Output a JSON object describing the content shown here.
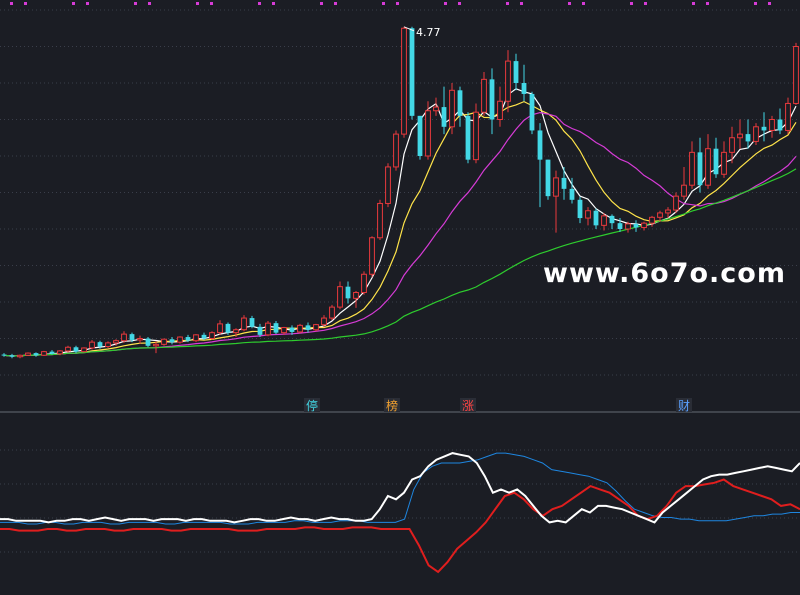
{
  "watermark": "www.6o7o.com",
  "chart_data": {
    "type": "candlestick",
    "peak_label": "4.77",
    "ylim": [
      0,
      5.0
    ],
    "grid": true,
    "colors": {
      "up": "#e8393c",
      "down": "#43d8e6",
      "ma_white": "#ffffff",
      "ma_yellow": "#ffe44a",
      "ma_magenta": "#d63bd6",
      "ma_green": "#2ecc2e",
      "ind_white": "#ffffff",
      "ind_blue": "#1e86e0",
      "ind_red": "#e01e1e",
      "marker_ting": "#43d8e6",
      "marker_bang": "#f0a030",
      "marker_zhang": "#ff4444",
      "marker_cai": "#5aa0ff"
    },
    "candles": [
      [
        0.28,
        0.3,
        0.25,
        0.27
      ],
      [
        0.27,
        0.29,
        0.23,
        0.25
      ],
      [
        0.25,
        0.28,
        0.23,
        0.27
      ],
      [
        0.27,
        0.31,
        0.26,
        0.3
      ],
      [
        0.3,
        0.31,
        0.25,
        0.27
      ],
      [
        0.27,
        0.33,
        0.26,
        0.32
      ],
      [
        0.32,
        0.34,
        0.28,
        0.29
      ],
      [
        0.29,
        0.34,
        0.27,
        0.33
      ],
      [
        0.33,
        0.4,
        0.31,
        0.38
      ],
      [
        0.38,
        0.4,
        0.3,
        0.32
      ],
      [
        0.32,
        0.38,
        0.31,
        0.37
      ],
      [
        0.37,
        0.48,
        0.35,
        0.45
      ],
      [
        0.45,
        0.47,
        0.36,
        0.39
      ],
      [
        0.39,
        0.46,
        0.37,
        0.44
      ],
      [
        0.44,
        0.49,
        0.4,
        0.47
      ],
      [
        0.47,
        0.6,
        0.44,
        0.56
      ],
      [
        0.56,
        0.58,
        0.45,
        0.48
      ],
      [
        0.48,
        0.54,
        0.43,
        0.5
      ],
      [
        0.5,
        0.52,
        0.38,
        0.4
      ],
      [
        0.4,
        0.46,
        0.3,
        0.42
      ],
      [
        0.42,
        0.5,
        0.4,
        0.49
      ],
      [
        0.49,
        0.52,
        0.42,
        0.45
      ],
      [
        0.45,
        0.53,
        0.43,
        0.52
      ],
      [
        0.52,
        0.55,
        0.45,
        0.47
      ],
      [
        0.47,
        0.56,
        0.45,
        0.55
      ],
      [
        0.55,
        0.58,
        0.48,
        0.5
      ],
      [
        0.5,
        0.6,
        0.48,
        0.58
      ],
      [
        0.58,
        0.75,
        0.55,
        0.7
      ],
      [
        0.7,
        0.72,
        0.55,
        0.58
      ],
      [
        0.58,
        0.64,
        0.52,
        0.62
      ],
      [
        0.62,
        0.82,
        0.6,
        0.78
      ],
      [
        0.78,
        0.81,
        0.64,
        0.66
      ],
      [
        0.66,
        0.7,
        0.52,
        0.55
      ],
      [
        0.55,
        0.74,
        0.53,
        0.71
      ],
      [
        0.71,
        0.74,
        0.56,
        0.58
      ],
      [
        0.58,
        0.66,
        0.55,
        0.65
      ],
      [
        0.65,
        0.68,
        0.55,
        0.59
      ],
      [
        0.59,
        0.7,
        0.57,
        0.68
      ],
      [
        0.68,
        0.72,
        0.58,
        0.62
      ],
      [
        0.62,
        0.7,
        0.6,
        0.69
      ],
      [
        0.69,
        0.82,
        0.66,
        0.78
      ],
      [
        0.78,
        0.96,
        0.75,
        0.93
      ],
      [
        0.93,
        1.28,
        0.9,
        1.21
      ],
      [
        1.21,
        1.28,
        0.98,
        1.05
      ],
      [
        1.05,
        1.15,
        0.92,
        1.13
      ],
      [
        1.13,
        1.42,
        1.1,
        1.38
      ],
      [
        1.38,
        1.9,
        1.34,
        1.88
      ],
      [
        1.88,
        2.4,
        1.85,
        2.35
      ],
      [
        2.35,
        2.9,
        2.3,
        2.85
      ],
      [
        2.85,
        3.35,
        2.8,
        3.3
      ],
      [
        3.3,
        4.77,
        3.25,
        4.75
      ],
      [
        4.75,
        4.77,
        3.5,
        3.55
      ],
      [
        3.55,
        3.55,
        2.95,
        3.0
      ],
      [
        3.0,
        3.75,
        2.95,
        3.62
      ],
      [
        3.62,
        3.8,
        3.55,
        3.67
      ],
      [
        3.67,
        3.95,
        3.3,
        3.4
      ],
      [
        3.4,
        4.0,
        3.3,
        3.9
      ],
      [
        3.9,
        3.95,
        3.4,
        3.55
      ],
      [
        3.55,
        3.6,
        2.9,
        2.95
      ],
      [
        2.95,
        3.72,
        2.9,
        3.6
      ],
      [
        3.6,
        4.15,
        3.55,
        4.05
      ],
      [
        4.05,
        4.2,
        3.3,
        3.5
      ],
      [
        3.5,
        3.95,
        3.4,
        3.75
      ],
      [
        3.75,
        4.45,
        3.6,
        4.3
      ],
      [
        4.3,
        4.4,
        3.9,
        4.0
      ],
      [
        4.0,
        4.25,
        3.75,
        3.85
      ],
      [
        3.85,
        3.88,
        3.3,
        3.35
      ],
      [
        3.35,
        3.45,
        2.3,
        2.95
      ],
      [
        2.95,
        2.95,
        2.4,
        2.45
      ],
      [
        2.45,
        2.8,
        1.95,
        2.7
      ],
      [
        2.7,
        2.85,
        2.4,
        2.55
      ],
      [
        2.55,
        2.7,
        2.35,
        2.4
      ],
      [
        2.4,
        2.44,
        2.08,
        2.15
      ],
      [
        2.15,
        2.3,
        2.05,
        2.25
      ],
      [
        2.25,
        2.28,
        2.0,
        2.05
      ],
      [
        2.05,
        2.22,
        1.98,
        2.18
      ],
      [
        2.18,
        2.2,
        2.0,
        2.08
      ],
      [
        2.08,
        2.15,
        1.96,
        2.0
      ],
      [
        2.0,
        2.1,
        1.95,
        2.07
      ],
      [
        2.07,
        2.12,
        1.96,
        2.02
      ],
      [
        2.02,
        2.1,
        1.98,
        2.08
      ],
      [
        2.08,
        2.18,
        2.03,
        2.16
      ],
      [
        2.16,
        2.25,
        2.1,
        2.22
      ],
      [
        2.22,
        2.3,
        2.15,
        2.26
      ],
      [
        2.26,
        2.5,
        2.22,
        2.45
      ],
      [
        2.45,
        2.85,
        2.4,
        2.6
      ],
      [
        2.6,
        3.2,
        2.55,
        3.05
      ],
      [
        3.05,
        3.25,
        2.5,
        2.6
      ],
      [
        2.6,
        3.3,
        2.55,
        3.1
      ],
      [
        3.1,
        3.25,
        2.7,
        2.75
      ],
      [
        2.75,
        3.2,
        2.7,
        3.05
      ],
      [
        3.05,
        3.4,
        2.9,
        3.25
      ],
      [
        3.25,
        3.5,
        3.1,
        3.3
      ],
      [
        3.3,
        3.5,
        3.1,
        3.2
      ],
      [
        3.2,
        3.45,
        3.15,
        3.4
      ],
      [
        3.4,
        3.6,
        3.2,
        3.35
      ],
      [
        3.35,
        3.55,
        3.25,
        3.5
      ],
      [
        3.5,
        3.65,
        3.3,
        3.35
      ],
      [
        3.35,
        3.8,
        3.3,
        3.72
      ],
      [
        3.72,
        4.55,
        3.7,
        4.5
      ]
    ],
    "ma_periods": [
      5,
      10,
      20,
      60
    ],
    "indicator": {
      "ylim": [
        0,
        100
      ],
      "white": [
        46,
        46,
        45,
        45,
        45,
        45,
        44,
        45,
        45,
        46,
        46,
        45,
        46,
        47,
        46,
        45,
        46,
        46,
        46,
        45,
        46,
        46,
        46,
        45,
        46,
        46,
        45,
        45,
        45,
        44,
        45,
        46,
        46,
        45,
        45,
        46,
        47,
        46,
        46,
        45,
        46,
        47,
        46,
        46,
        45,
        45,
        46,
        52,
        60,
        58,
        62,
        70,
        72,
        78,
        82,
        84,
        86,
        85,
        84,
        80,
        72,
        62,
        64,
        62,
        64,
        60,
        54,
        48,
        44,
        45,
        44,
        48,
        52,
        50,
        54,
        54,
        53,
        52,
        50,
        48,
        46,
        44,
        50,
        54,
        58,
        62,
        66,
        70,
        72,
        73,
        73,
        74,
        75,
        76,
        77,
        78,
        77,
        76,
        75,
        80
      ],
      "blue": [
        44,
        44,
        44,
        43,
        43,
        44,
        44,
        43,
        43,
        44,
        44,
        44,
        43,
        43,
        44,
        44,
        44,
        44,
        43,
        43,
        44,
        44,
        44,
        44,
        44,
        43,
        43,
        43,
        44,
        44,
        44,
        44,
        45,
        45,
        44,
        44,
        44,
        45,
        45,
        45,
        44,
        44,
        44,
        44,
        46,
        64,
        74,
        78,
        80,
        80,
        80,
        81,
        82,
        84,
        86,
        86,
        85,
        84,
        82,
        80,
        76,
        75,
        74,
        73,
        72,
        70,
        68,
        63,
        57,
        52,
        50,
        48,
        47,
        47,
        46,
        46,
        45,
        45,
        45,
        45,
        46,
        47,
        48,
        48,
        49,
        49,
        50,
        50
      ],
      "red": [
        40,
        40,
        39,
        39,
        39,
        40,
        40,
        39,
        39,
        40,
        40,
        40,
        39,
        39,
        40,
        40,
        40,
        40,
        39,
        39,
        40,
        40,
        40,
        40,
        40,
        39,
        39,
        39,
        40,
        40,
        40,
        40,
        41,
        41,
        40,
        40,
        40,
        41,
        41,
        41,
        40,
        40,
        40,
        40,
        30,
        18,
        14,
        20,
        28,
        33,
        38,
        44,
        52,
        60,
        62,
        58,
        52,
        48,
        52,
        54,
        58,
        62,
        66,
        64,
        62,
        58,
        54,
        48,
        46,
        48,
        54,
        62,
        66,
        66,
        67,
        68,
        70,
        66,
        64,
        62,
        60,
        58,
        54,
        55,
        52
      ]
    },
    "markers": [
      {
        "text": "停",
        "pos": 0.39
      },
      {
        "text": "榜",
        "pos": 0.49
      },
      {
        "text": "涨",
        "pos": 0.585
      },
      {
        "text": "财",
        "pos": 0.855
      }
    ]
  }
}
